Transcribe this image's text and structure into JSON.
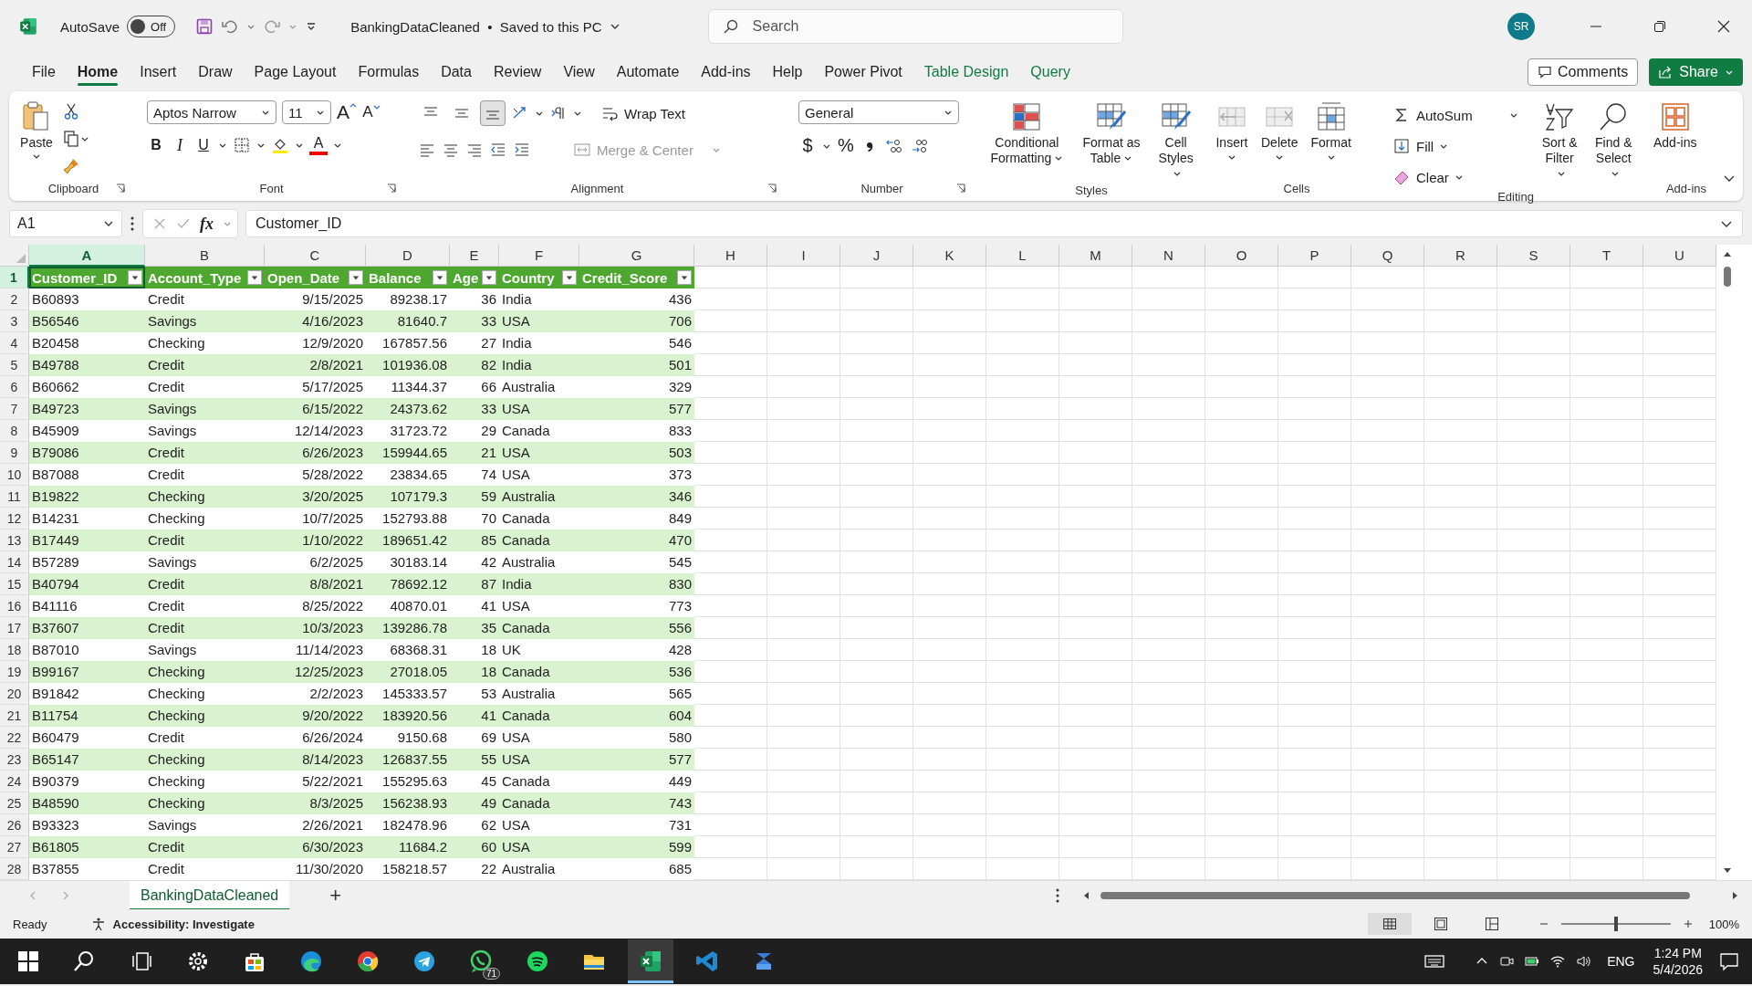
{
  "title_bar": {
    "autosave_label": "AutoSave",
    "autosave_toggle": {
      "on": false,
      "label": "Off"
    },
    "document_title": "BankingDataCleaned  •  Saved to this PC",
    "search": {
      "placeholder": "Search"
    },
    "avatar": "SR"
  },
  "menu_tabs": [
    {
      "label": "File",
      "selected": false,
      "contextual": false
    },
    {
      "label": "Home",
      "selected": true,
      "contextual": false
    },
    {
      "label": "Insert",
      "selected": false,
      "contextual": false
    },
    {
      "label": "Draw",
      "selected": false,
      "contextual": false
    },
    {
      "label": "Page Layout",
      "selected": false,
      "contextual": false
    },
    {
      "label": "Formulas",
      "selected": false,
      "contextual": false
    },
    {
      "label": "Data",
      "selected": false,
      "contextual": false
    },
    {
      "label": "Review",
      "selected": false,
      "contextual": false
    },
    {
      "label": "View",
      "selected": false,
      "contextual": false
    },
    {
      "label": "Automate",
      "selected": false,
      "contextual": false
    },
    {
      "label": "Add-ins",
      "selected": false,
      "contextual": false
    },
    {
      "label": "Help",
      "selected": false,
      "contextual": false
    },
    {
      "label": "Power Pivot",
      "selected": false,
      "contextual": false
    },
    {
      "label": "Table Design",
      "selected": false,
      "contextual": true
    },
    {
      "label": "Query",
      "selected": false,
      "contextual": true
    }
  ],
  "comments_button": "Comments",
  "share_button": "Share",
  "ribbon": {
    "clipboard": {
      "paste": "Paste",
      "label": "Clipboard"
    },
    "font": {
      "family": "Aptos Narrow",
      "size": "11",
      "grow": "A",
      "shrink": "A",
      "bold": "B",
      "italic": "I",
      "underline": "U",
      "font_color": "A",
      "label": "Font"
    },
    "alignment": {
      "vertical": [
        {
          "selected": false
        },
        {
          "selected": false
        },
        {
          "selected": true
        }
      ],
      "wrap_text": "Wrap Text",
      "merge_center": {
        "label": "Merge & Center",
        "disabled": true
      },
      "label": "Alignment"
    },
    "number": {
      "format": "General",
      "currency": "$",
      "percent": "%",
      "label": "Number"
    },
    "styles": {
      "buttons": [
        "Conditional Formatting",
        "Format as Table",
        "Cell Styles"
      ],
      "label": "Styles"
    },
    "cells": {
      "buttons": [
        "Insert",
        "Delete",
        "Format"
      ],
      "label": "Cells"
    },
    "editing": {
      "autosum": "AutoSum",
      "fill": "Fill",
      "clear": "Clear",
      "sort_filter": "Sort & Filter",
      "find_select": "Find & Select",
      "label": "Editing"
    },
    "addins": {
      "button": "Add-ins",
      "label": "Add-ins"
    }
  },
  "formula_bar": {
    "name_box": "A1",
    "fx": "fx",
    "formula": "Customer_ID"
  },
  "column_letters": [
    {
      "label": "A",
      "selected": true
    },
    {
      "label": "B",
      "selected": false
    },
    {
      "label": "C",
      "selected": false
    },
    {
      "label": "D",
      "selected": false
    },
    {
      "label": "E",
      "selected": false
    },
    {
      "label": "F",
      "selected": false
    },
    {
      "label": "G",
      "selected": false
    },
    {
      "label": "H",
      "selected": false
    },
    {
      "label": "I",
      "selected": false
    },
    {
      "label": "J",
      "selected": false
    },
    {
      "label": "K",
      "selected": false
    },
    {
      "label": "L",
      "selected": false
    },
    {
      "label": "M",
      "selected": false
    },
    {
      "label": "N",
      "selected": false
    },
    {
      "label": "O",
      "selected": false
    },
    {
      "label": "P",
      "selected": false
    },
    {
      "label": "Q",
      "selected": false
    },
    {
      "label": "R",
      "selected": false
    },
    {
      "label": "S",
      "selected": false
    },
    {
      "label": "T",
      "selected": false
    },
    {
      "label": "U",
      "selected": false
    }
  ],
  "row_numbers": [
    {
      "label": "1",
      "selected": true
    },
    {
      "label": "2",
      "selected": false
    },
    {
      "label": "3",
      "selected": false
    },
    {
      "label": "4",
      "selected": false
    },
    {
      "label": "5",
      "selected": false
    },
    {
      "label": "6",
      "selected": false
    },
    {
      "label": "7",
      "selected": false
    },
    {
      "label": "8",
      "selected": false
    },
    {
      "label": "9",
      "selected": false
    },
    {
      "label": "10",
      "selected": false
    },
    {
      "label": "11",
      "selected": false
    },
    {
      "label": "12",
      "selected": false
    },
    {
      "label": "13",
      "selected": false
    },
    {
      "label": "14",
      "selected": false
    },
    {
      "label": "15",
      "selected": false
    },
    {
      "label": "16",
      "selected": false
    },
    {
      "label": "17",
      "selected": false
    },
    {
      "label": "18",
      "selected": false
    },
    {
      "label": "19",
      "selected": false
    },
    {
      "label": "20",
      "selected": false
    },
    {
      "label": "21",
      "selected": false
    },
    {
      "label": "22",
      "selected": false
    },
    {
      "label": "23",
      "selected": false
    },
    {
      "label": "24",
      "selected": false
    },
    {
      "label": "25",
      "selected": false
    },
    {
      "label": "26",
      "selected": false
    },
    {
      "label": "27",
      "selected": false
    },
    {
      "label": "28",
      "selected": false
    }
  ],
  "table": {
    "columns": [
      {
        "label": "Customer_ID",
        "kind": "text",
        "selected": true
      },
      {
        "label": "Account_Type",
        "kind": "text",
        "selected": false
      },
      {
        "label": "Open_Date",
        "kind": "number",
        "selected": false
      },
      {
        "label": "Balance",
        "kind": "number",
        "selected": false
      },
      {
        "label": "Age",
        "kind": "number",
        "selected": false
      },
      {
        "label": "Country",
        "kind": "text",
        "selected": false
      },
      {
        "label": "Credit_Score",
        "kind": "number",
        "selected": false
      }
    ],
    "rows": [
      [
        "B60893",
        "Credit",
        "9/15/2025",
        "89238.17",
        "36",
        "India",
        "436"
      ],
      [
        "B56546",
        "Savings",
        "4/16/2023",
        "81640.7",
        "33",
        "USA",
        "706"
      ],
      [
        "B20458",
        "Checking",
        "12/9/2020",
        "167857.56",
        "27",
        "India",
        "546"
      ],
      [
        "B49788",
        "Credit",
        "2/8/2021",
        "101936.08",
        "82",
        "India",
        "501"
      ],
      [
        "B60662",
        "Credit",
        "5/17/2025",
        "11344.37",
        "66",
        "Australia",
        "329"
      ],
      [
        "B49723",
        "Savings",
        "6/15/2022",
        "24373.62",
        "33",
        "USA",
        "577"
      ],
      [
        "B45909",
        "Savings",
        "12/14/2023",
        "31723.72",
        "29",
        "Canada",
        "833"
      ],
      [
        "B79086",
        "Credit",
        "6/26/2023",
        "159944.65",
        "21",
        "USA",
        "503"
      ],
      [
        "B87088",
        "Credit",
        "5/28/2022",
        "23834.65",
        "74",
        "USA",
        "373"
      ],
      [
        "B19822",
        "Checking",
        "3/20/2025",
        "107179.3",
        "59",
        "Australia",
        "346"
      ],
      [
        "B14231",
        "Checking",
        "10/7/2025",
        "152793.88",
        "70",
        "Canada",
        "849"
      ],
      [
        "B17449",
        "Credit",
        "1/10/2022",
        "189651.42",
        "85",
        "Canada",
        "470"
      ],
      [
        "B57289",
        "Savings",
        "6/2/2025",
        "30183.14",
        "42",
        "Australia",
        "545"
      ],
      [
        "B40794",
        "Credit",
        "8/8/2021",
        "78692.12",
        "87",
        "India",
        "830"
      ],
      [
        "B41116",
        "Credit",
        "8/25/2022",
        "40870.01",
        "41",
        "USA",
        "773"
      ],
      [
        "B37607",
        "Credit",
        "10/3/2023",
        "139286.78",
        "35",
        "Canada",
        "556"
      ],
      [
        "B87010",
        "Savings",
        "11/14/2023",
        "68368.31",
        "18",
        "UK",
        "428"
      ],
      [
        "B99167",
        "Checking",
        "12/25/2023",
        "27018.05",
        "18",
        "Canada",
        "536"
      ],
      [
        "B91842",
        "Checking",
        "2/2/2023",
        "145333.57",
        "53",
        "Australia",
        "565"
      ],
      [
        "B11754",
        "Checking",
        "9/20/2022",
        "183920.56",
        "41",
        "Canada",
        "604"
      ],
      [
        "B60479",
        "Credit",
        "6/26/2024",
        "9150.68",
        "69",
        "USA",
        "580"
      ],
      [
        "B65147",
        "Checking",
        "8/14/2023",
        "126837.55",
        "55",
        "USA",
        "577"
      ],
      [
        "B90379",
        "Checking",
        "5/22/2021",
        "155295.63",
        "45",
        "Canada",
        "449"
      ],
      [
        "B48590",
        "Checking",
        "8/3/2025",
        "156238.93",
        "49",
        "Canada",
        "743"
      ],
      [
        "B93323",
        "Savings",
        "2/26/2021",
        "182478.96",
        "62",
        "USA",
        "731"
      ],
      [
        "B61805",
        "Credit",
        "6/30/2023",
        "11684.2",
        "60",
        "USA",
        "599"
      ],
      [
        "B37855",
        "Credit",
        "11/30/2020",
        "158218.57",
        "22",
        "Australia",
        "685"
      ]
    ]
  },
  "sheet_tabs": [
    {
      "label": "BankingDataCleaned",
      "selected": true
    }
  ],
  "add_sheet": "+",
  "status_bar": {
    "status": "Ready",
    "accessibility": "Accessibility: Investigate",
    "views": [
      {
        "selected": true
      },
      {
        "selected": false
      },
      {
        "selected": false
      }
    ],
    "zoom": {
      "level": 0.5,
      "reading": "100%"
    }
  },
  "taskbar": {
    "apps": [
      {
        "kind": "start",
        "selected": false
      },
      {
        "kind": "search",
        "selected": false
      },
      {
        "kind": "taskview",
        "selected": false
      },
      {
        "kind": "settings",
        "selected": false
      },
      {
        "kind": "store",
        "selected": false
      },
      {
        "kind": "edge",
        "selected": false
      },
      {
        "kind": "chrome",
        "selected": false
      },
      {
        "kind": "telegram",
        "selected": false
      },
      {
        "kind": "whatsapp",
        "selected": false,
        "badge": "71"
      },
      {
        "kind": "spotify",
        "selected": false
      },
      {
        "kind": "files",
        "selected": false
      },
      {
        "kind": "excel",
        "selected": true
      },
      {
        "kind": "vscode",
        "selected": false
      },
      {
        "kind": "app",
        "selected": false
      }
    ],
    "language": "ENG",
    "time": "1:24 PM",
    "date": "5/4/2026"
  }
}
